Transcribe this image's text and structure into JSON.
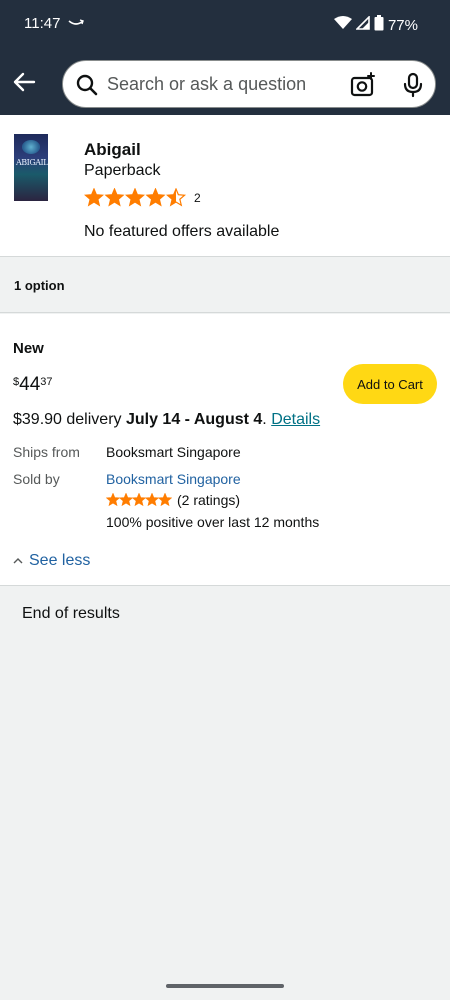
{
  "status": {
    "time": "11:47",
    "battery": "77%"
  },
  "search": {
    "placeholder": "Search or ask a question"
  },
  "product": {
    "title": "Abigail",
    "format": "Paperback",
    "cover_text": "ABIGAIL",
    "rating_stars": 4.5,
    "rating_count": "2",
    "offers_note": "No featured offers available"
  },
  "options": {
    "count_label": "1 option"
  },
  "offer": {
    "condition": "New",
    "price_symbol": "$",
    "price_whole": "44",
    "price_fraction": "37",
    "add_to_cart": "Add to Cart",
    "delivery_prefix": "$39.90 delivery ",
    "delivery_dates": "July 14 - August 4",
    "delivery_suffix": ". ",
    "details_link": "Details",
    "ships_from_label": "Ships from",
    "ships_from_value": "Booksmart Singapore",
    "sold_by_label": "Sold by",
    "sold_by_value": "Booksmart Singapore",
    "seller_stars": 5,
    "seller_ratings": "(2 ratings)",
    "seller_positive": "100% positive over last 12 months",
    "see_less": "See less"
  },
  "footer": {
    "end_of_results": "End of results"
  },
  "colors": {
    "header_bg": "#232f3e",
    "star": "#ff7d00",
    "link": "#2162a1",
    "add_to_cart_bg": "#ffd814"
  },
  "icons": [
    "back-arrow-icon",
    "search-icon",
    "camera-icon",
    "mic-icon",
    "wifi-icon",
    "signal-icon",
    "battery-icon",
    "chevron-up-icon",
    "star-icon"
  ]
}
